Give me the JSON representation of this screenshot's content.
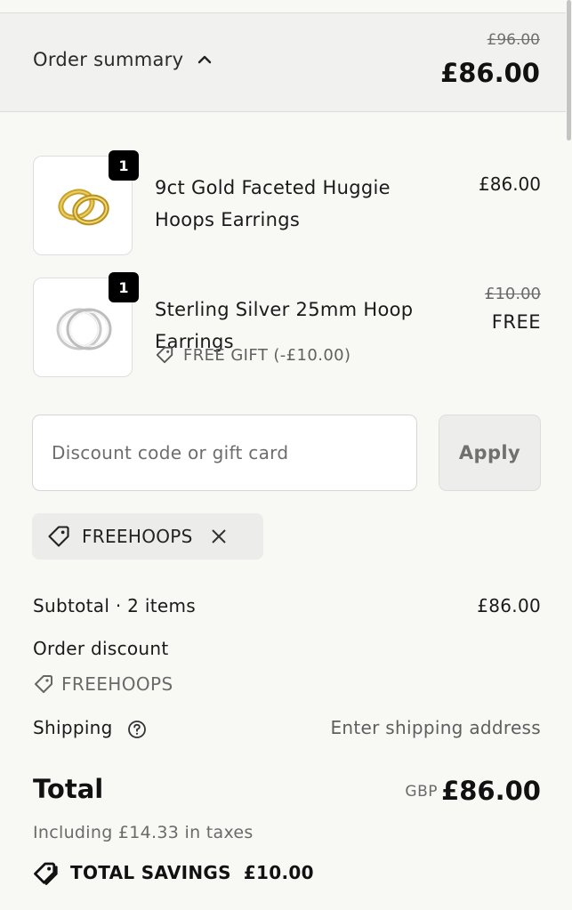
{
  "summary": {
    "toggle_label": "Order summary",
    "original_total": "£96.00",
    "total": "£86.00"
  },
  "items": [
    {
      "quantity": "1",
      "name": "9ct Gold Faceted Huggie Hoops Earrings",
      "price": "£86.00"
    },
    {
      "quantity": "1",
      "name": "Sterling Silver 25mm Hoop Earrings",
      "original_price": "£10.00",
      "price": "FREE",
      "gift_label": "FREE GIFT (-£10.00)"
    }
  ],
  "discount": {
    "placeholder": "Discount code or gift card",
    "apply_label": "Apply",
    "applied_code": "FREEHOOPS"
  },
  "lines": {
    "subtotal_label": "Subtotal · 2 items",
    "subtotal_value": "£86.00",
    "order_discount_label": "Order discount",
    "order_discount_code": "FREEHOOPS",
    "shipping_label": "Shipping",
    "shipping_value": "Enter shipping address"
  },
  "total": {
    "label": "Total",
    "currency": "GBP",
    "amount": "£86.00",
    "taxes_note": "Including £14.33 in taxes"
  },
  "savings": {
    "label": "TOTAL SAVINGS",
    "amount": "£10.00"
  }
}
